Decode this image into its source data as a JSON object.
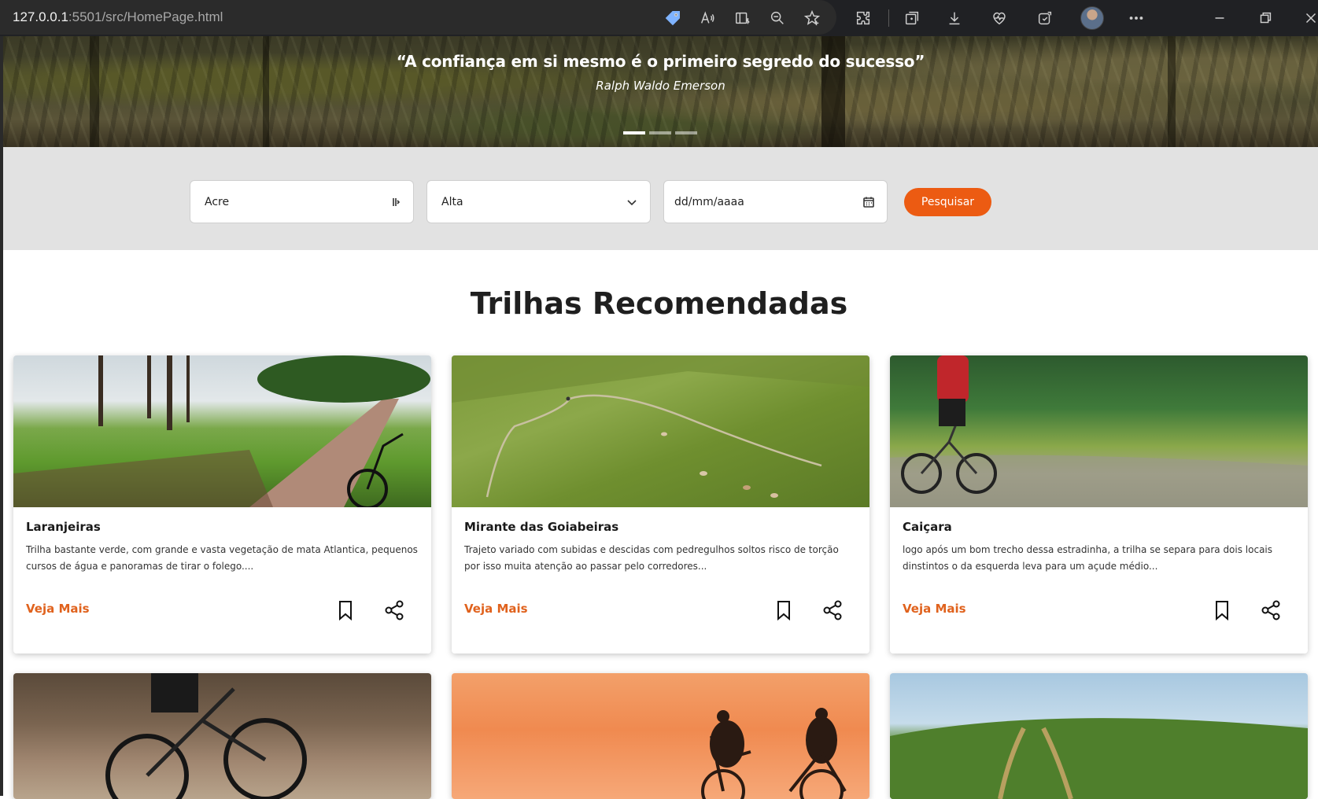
{
  "browser": {
    "url_host": "127.0.0.1",
    "url_path": ":5501/src/HomePage.html"
  },
  "hero": {
    "quote": "“A confiança em si mesmo é o primeiro segredo do sucesso”",
    "author": "Ralph Waldo Emerson",
    "slides_total": 3,
    "slide_active": 1
  },
  "search": {
    "state_value": "Acre",
    "difficulty_value": "Alta",
    "date_placeholder": "dd/mm/aaaa",
    "button_label": "Pesquisar"
  },
  "section": {
    "title": "Trilhas Recomendadas"
  },
  "cards": [
    {
      "title": "Laranjeiras",
      "description": "Trilha bastante verde, com grande e vasta vegetação de mata Atlantica, pequenos cursos de água e panoramas de tirar o folego....",
      "more_label": "Veja Mais"
    },
    {
      "title": "Mirante das Goiabeiras",
      "description": "Trajeto variado com subidas e descidas com pedregulhos soltos risco de torção por isso muita atenção ao passar pelo corredores...",
      "more_label": "Veja Mais"
    },
    {
      "title": "Caiçara",
      "description": "logo após um bom trecho dessa estradinha, a trilha se separa para dois locais dinstintos o da esquerda leva para um açude médio...",
      "more_label": "Veja Mais"
    }
  ],
  "colors": {
    "accent": "#ec5b12",
    "link": "#e0621d",
    "search_band": "#e2e2e2"
  }
}
